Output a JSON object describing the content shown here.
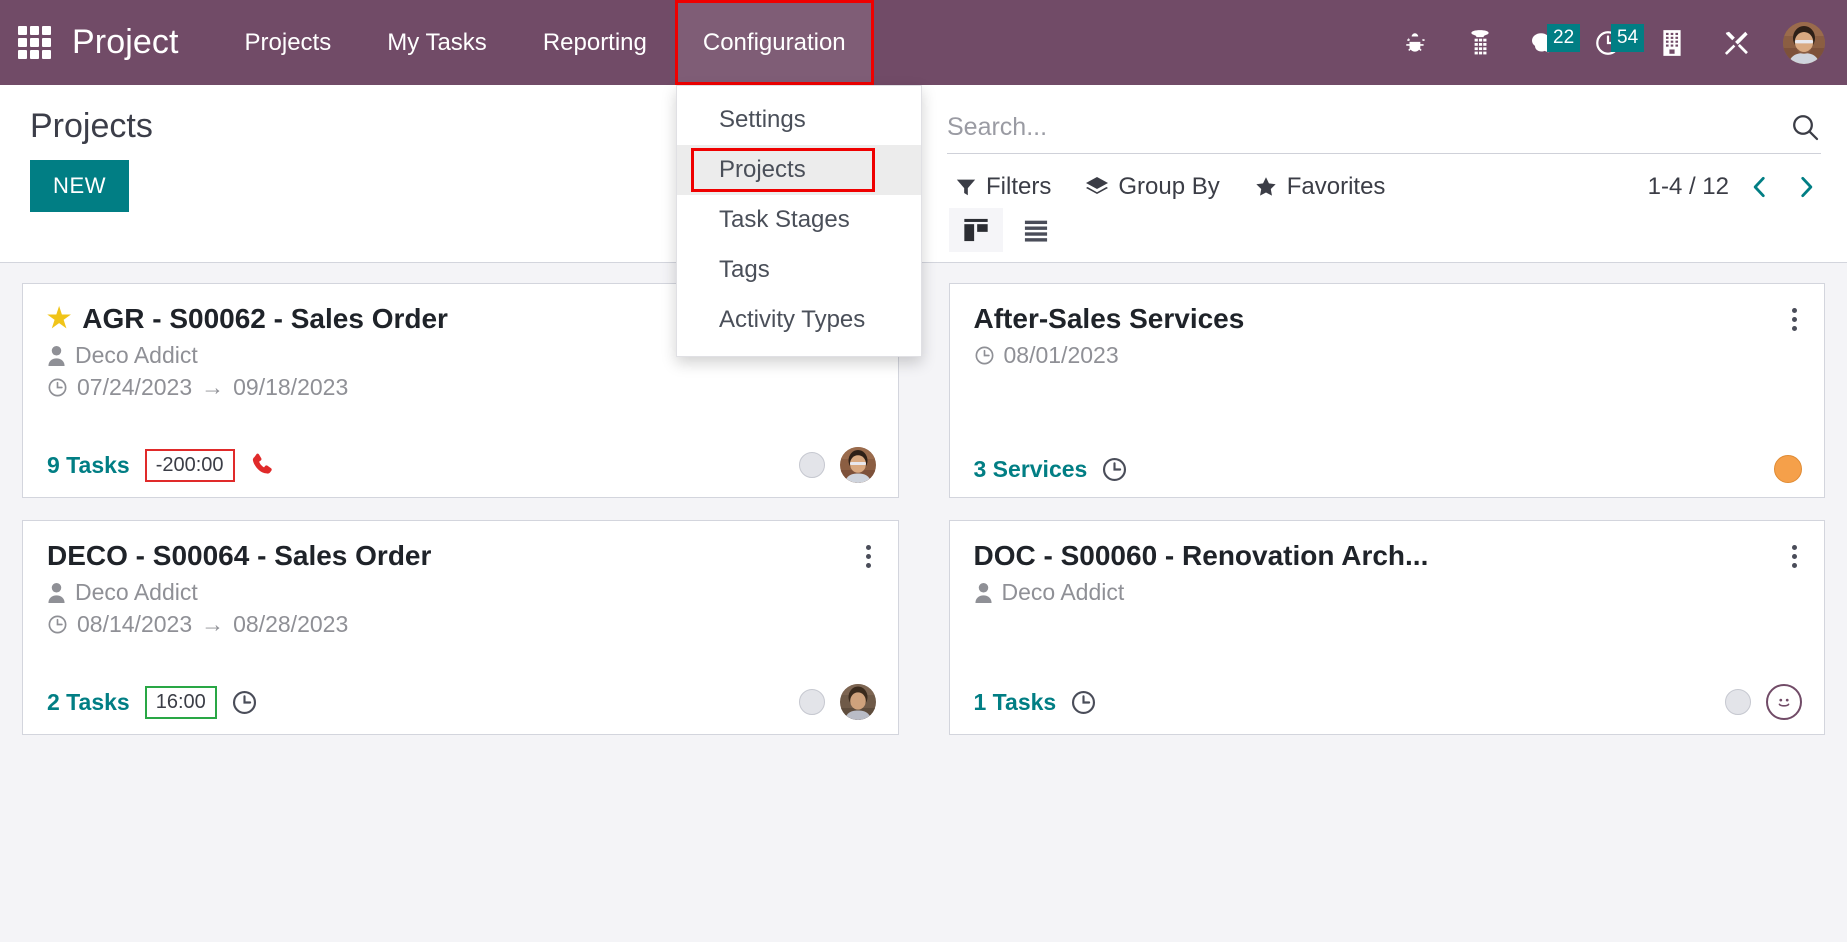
{
  "navbar": {
    "apps_icon": "apps-grid-icon",
    "brand": "Project",
    "menu": [
      {
        "label": "Projects",
        "active": false
      },
      {
        "label": "My Tasks",
        "active": false
      },
      {
        "label": "Reporting",
        "active": false
      },
      {
        "label": "Configuration",
        "active": true
      }
    ],
    "right_icons": [
      {
        "name": "bug-icon",
        "badge": ""
      },
      {
        "name": "dialpad-icon",
        "badge": ""
      },
      {
        "name": "messages-icon",
        "badge": "22"
      },
      {
        "name": "activities-clock-icon",
        "badge": "54"
      },
      {
        "name": "company-building-icon",
        "badge": ""
      },
      {
        "name": "tools-icon",
        "badge": ""
      }
    ],
    "avatar_name": "user-avatar"
  },
  "dropdown": {
    "open_for": "Configuration",
    "items": [
      {
        "label": "Settings",
        "highlighted": false
      },
      {
        "label": "Projects",
        "highlighted": true
      },
      {
        "label": "Task Stages",
        "highlighted": false
      },
      {
        "label": "Tags",
        "highlighted": false
      },
      {
        "label": "Activity Types",
        "highlighted": false
      }
    ]
  },
  "control_panel": {
    "title": "Projects",
    "new_button": "NEW",
    "search": {
      "value": "",
      "placeholder": "Search..."
    },
    "filters": [
      {
        "label": "Filters",
        "icon": "filter-funnel-icon"
      },
      {
        "label": "Group By",
        "icon": "group-by-layers-icon"
      },
      {
        "label": "Favorites",
        "icon": "star-icon"
      }
    ],
    "pager": {
      "count": "1-4 / 12",
      "prev": "previous-page",
      "next": "next-page"
    },
    "views": [
      {
        "name": "kanban-view",
        "active": true
      },
      {
        "name": "list-view",
        "active": false
      }
    ]
  },
  "colors": {
    "navbar": "#714B67",
    "accent_teal": "#017e84",
    "highlight_red": "#ef0000",
    "badge_teal": "#017e84",
    "star_yellow": "#f0c419",
    "overtime_red": "#e02a2a",
    "ontime_green": "#29a745",
    "status_orange": "#f5a04a",
    "kanban_bg": "#f4f4f7"
  },
  "cards": [
    {
      "title": "AGR - S00062 - Sales Order",
      "starred": true,
      "customer": "Deco Addict",
      "date_start": "07/24/2023",
      "date_end": "09/18/2023",
      "date_arrow": "→",
      "tasks_label": "9 Tasks",
      "time_badge": "-200:00",
      "time_badge_state": "negative",
      "foot_icon": "phone-icon",
      "status_dot": "grey",
      "avatar": "photo",
      "kebab": "card-menu"
    },
    {
      "title": "After-Sales Services",
      "starred": false,
      "customer": "",
      "date_start": "08/01/2023",
      "date_end": "",
      "date_arrow": "",
      "tasks_label": "3 Services",
      "time_badge": "",
      "time_badge_state": "none",
      "foot_icon": "clock-icon",
      "status_dot": "orange",
      "avatar": "none",
      "kebab": "card-menu"
    },
    {
      "title": "DECO - S00064 - Sales Order",
      "starred": false,
      "customer": "Deco Addict",
      "date_start": "08/14/2023",
      "date_end": "08/28/2023",
      "date_arrow": "→",
      "tasks_label": "2 Tasks",
      "time_badge": "16:00",
      "time_badge_state": "positive",
      "foot_icon": "clock-icon",
      "status_dot": "grey",
      "avatar": "photo",
      "kebab": "card-menu"
    },
    {
      "title": "DOC - S00060 - Renovation Arch...",
      "starred": false,
      "customer": "Deco Addict",
      "date_start": "",
      "date_end": "",
      "date_arrow": "",
      "tasks_label": "1 Tasks",
      "time_badge": "",
      "time_badge_state": "none",
      "foot_icon": "clock-icon",
      "status_dot": "grey",
      "avatar": "smiley",
      "kebab": "card-menu"
    }
  ]
}
